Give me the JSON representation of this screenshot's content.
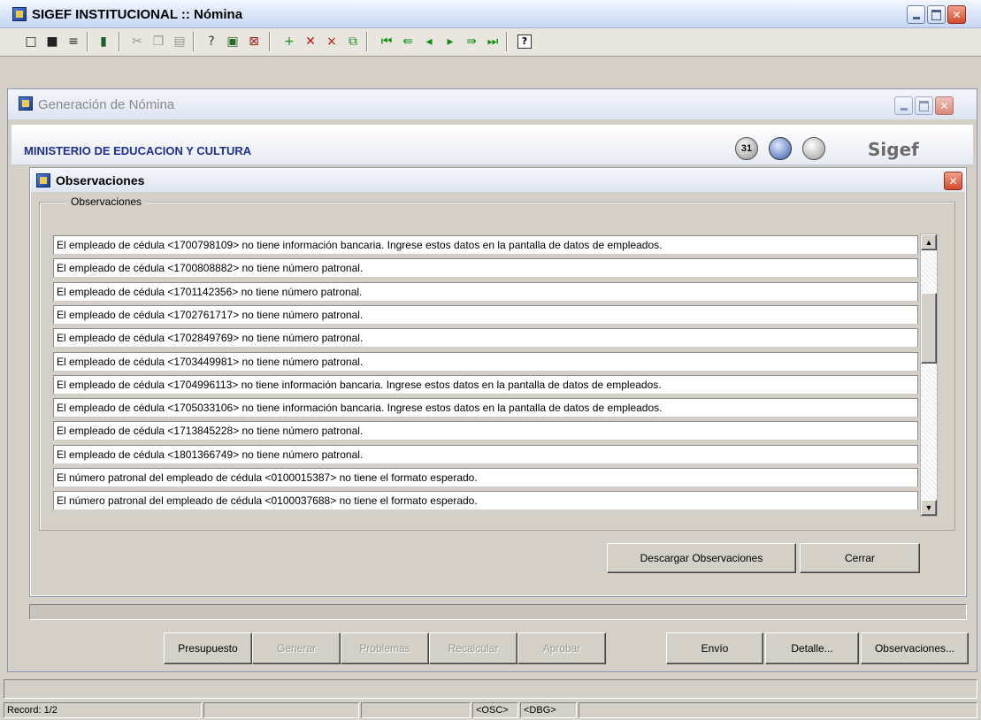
{
  "app": {
    "title": "SIGEF INSTITUCIONAL :: Nómina",
    "toolbar_icons": [
      "new-icon",
      "save-icon",
      "print-icon",
      "exit-icon",
      "cut-icon",
      "copy-icon",
      "paste-icon",
      "query-icon",
      "execute-query-icon",
      "cancel-query-icon",
      "insert-record-icon",
      "delete-record-icon",
      "clear-record-icon",
      "duplicate-record-icon",
      "first-record-icon",
      "previous-block-icon",
      "previous-record-icon",
      "next-record-icon",
      "next-block-icon",
      "last-record-icon",
      "help-icon"
    ]
  },
  "child_window": {
    "title": "Generación de Nómina",
    "ministry": "MINISTERIO DE EDUCACION Y CULTURA",
    "logo_text": "Sigef",
    "badge_31": "31"
  },
  "dialog": {
    "title": "Observaciones",
    "group_label": "Observaciones",
    "rows": [
      "El empleado de cédula <1700798109> no tiene información bancaria. Ingrese estos datos en la pantalla de datos de empleados.",
      "El empleado de cédula <1700808882> no tiene número patronal.",
      "El empleado de cédula <1701142356> no tiene número patronal.",
      "El empleado de cédula <1702761717> no tiene número patronal.",
      "El empleado de cédula <1702849769> no tiene número patronal.",
      "El empleado de cédula <1703449981> no tiene número patronal.",
      "El empleado de cédula <1704996113> no tiene información bancaria. Ingrese estos datos en la pantalla de datos de empleados.",
      "El empleado de cédula <1705033106> no tiene información bancaria. Ingrese estos datos en la pantalla de datos de empleados.",
      "El empleado de cédula <1713845228> no tiene número patronal.",
      "El empleado de cédula <1801366749> no tiene número patronal.",
      "El número patronal del empleado de cédula <0100015387> no tiene el formato esperado.",
      "El número patronal del empleado de cédula <0100037688> no tiene el formato esperado."
    ],
    "download_label": "Descargar Observaciones",
    "close_label": "Cerrar"
  },
  "bottom_buttons": {
    "presupuesto": "Presupuesto",
    "generar": "Generar",
    "problemas": "Problemas",
    "recalcular": "Recalcular",
    "aprobar": "Aprobar",
    "envio": "Envío",
    "detalle": "Detalle...",
    "observaciones": "Observaciones..."
  },
  "status": {
    "record": "Record: 1/2",
    "osc": "<OSC>",
    "dbg": "<DBG>"
  },
  "colors": {
    "ministry_text": "#1e2f8f",
    "title_text": "#000000",
    "close_button": "#d44a2a"
  }
}
